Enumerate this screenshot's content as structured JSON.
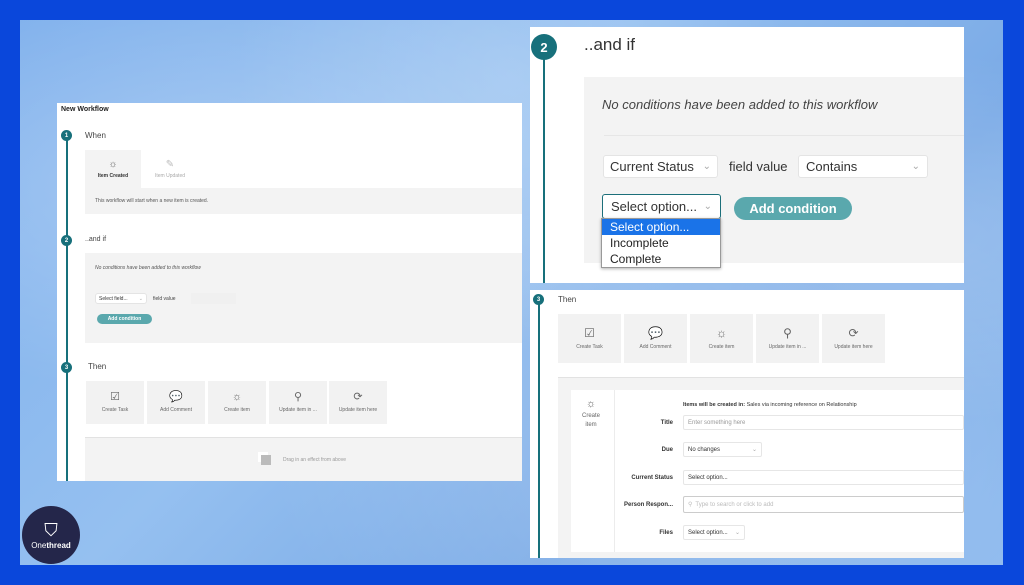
{
  "brand": {
    "name_light": "One",
    "name_bold": "thread",
    "frame_color": "#0a47db",
    "accent": "#17707b",
    "button_color": "#5aa8ad"
  },
  "left": {
    "title": "New Workflow",
    "steps": [
      {
        "number": "1",
        "heading": "When"
      },
      {
        "number": "2",
        "heading": "..and if"
      },
      {
        "number": "3",
        "heading": "Then"
      }
    ],
    "triggers": [
      {
        "icon": "sun-icon",
        "label": "Item Created",
        "selected": true
      },
      {
        "icon": "pencil-icon",
        "label": "Item Updated",
        "selected": false
      }
    ],
    "trigger_description": "This workflow will start when a new item is created.",
    "conditions_empty": "No conditions have been added to this workflow",
    "field_select": "Select field...",
    "field_value_label": "field value",
    "add_condition": "Add condition",
    "actions": [
      {
        "icon": "checkbox-icon",
        "label": "Create Task"
      },
      {
        "icon": "comment-icon",
        "label": "Add Comment"
      },
      {
        "icon": "sun-icon",
        "label": "Create item"
      },
      {
        "icon": "hierarchy-icon",
        "label": "Update item in ..."
      },
      {
        "icon": "sync-icon",
        "label": "Update item here"
      }
    ],
    "drop_hint": "Drag in an effect from above"
  },
  "right_top": {
    "step_number": "2",
    "heading": "..and if",
    "conditions_empty": "No conditions have been added to this workflow",
    "field_select": "Current Status",
    "field_value_label": "field value",
    "operator_select": "Contains",
    "value_select": "Select option...",
    "add_condition": "Add condition",
    "dropdown_options": [
      "Select option...",
      "Incomplete",
      "Complete"
    ],
    "dropdown_highlighted": "Select option..."
  },
  "right_bottom": {
    "step_number": "3",
    "heading": "Then",
    "actions": [
      {
        "icon": "checkbox-icon",
        "label": "Create Task"
      },
      {
        "icon": "comment-icon",
        "label": "Add Comment"
      },
      {
        "icon": "sun-icon",
        "label": "Create item"
      },
      {
        "icon": "hierarchy-icon",
        "label": "Update item in ..."
      },
      {
        "icon": "sync-icon",
        "label": "Update item here"
      }
    ],
    "effect_label_line1": "Create",
    "effect_label_line2": "item",
    "created_in_label": "Items will be created in:",
    "created_in_value": "Sales via incoming reference on Relationship",
    "form": {
      "title_label": "Title",
      "title_placeholder": "Enter something here",
      "due_label": "Due",
      "due_value": "No changes",
      "status_label": "Current Status",
      "status_value": "Select option...",
      "person_label": "Person Respon...",
      "person_placeholder": "Type to search or click to add",
      "files_label": "Files",
      "files_value": "Select option..."
    }
  }
}
